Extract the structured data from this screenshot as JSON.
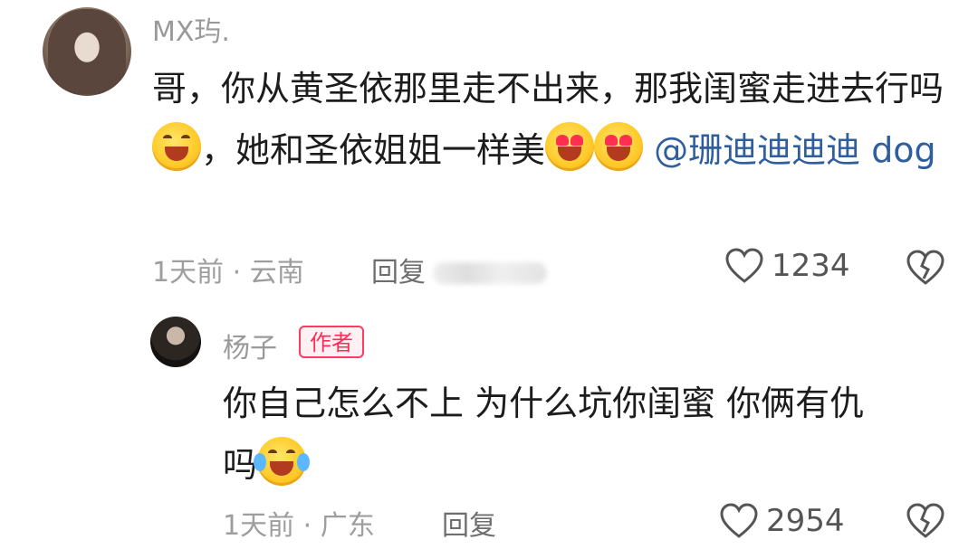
{
  "comment": {
    "username": "MX玙.",
    "text_parts": [
      "哥，你从黄圣依那里走不出来，那我闺蜜走进去行吗",
      "，她和圣依姐姐一样美",
      "@珊迪迪迪迪 dog"
    ],
    "emojis": [
      "wink-laugh-emoji",
      "heart-eyes-emoji",
      "heart-eyes-emoji"
    ],
    "time": "1天前",
    "separator": "·",
    "location": "云南",
    "reply_label": "回复",
    "like_count": "1234"
  },
  "reply": {
    "username": "杨子",
    "badge": "作者",
    "text_line1": "你自己怎么不上 为什么坑你闺蜜 你俩有仇",
    "text_line2": "吗",
    "emoji": "laugh-tears-emoji",
    "time": "1天前",
    "separator": "·",
    "location": "广东",
    "reply_label": "回复",
    "like_count": "2954"
  },
  "colors": {
    "mention": "#2f5e9e",
    "badge": "#ff2d55",
    "meta": "#9e9e9e"
  }
}
